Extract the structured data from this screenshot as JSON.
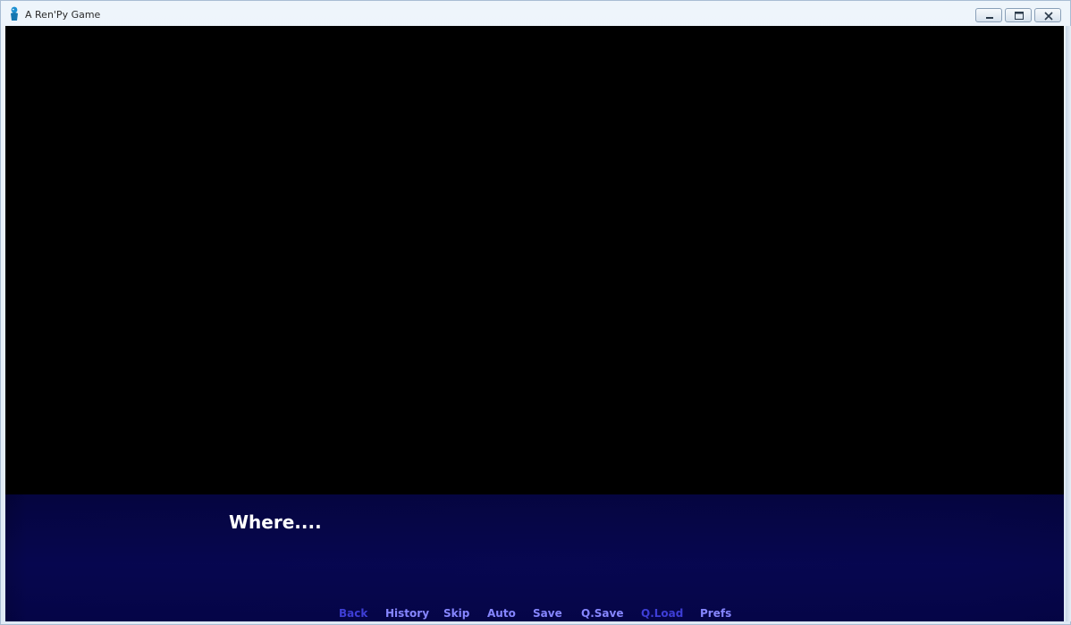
{
  "window": {
    "title": "A Ren'Py Game",
    "icon": "renpy-icon",
    "controls": [
      "minimize-icon",
      "maximize-icon",
      "close-icon"
    ]
  },
  "dialogue": {
    "text": "Where...."
  },
  "quick_menu": {
    "items": [
      {
        "label": "Back",
        "state": "disabled"
      },
      {
        "label": "History",
        "state": "enabled"
      },
      {
        "label": "Skip",
        "state": "enabled"
      },
      {
        "label": "Auto",
        "state": "enabled"
      },
      {
        "label": "Save",
        "state": "enabled"
      },
      {
        "label": "Q.Save",
        "state": "enabled"
      },
      {
        "label": "Q.Load",
        "state": "disabled"
      },
      {
        "label": "Prefs",
        "state": "enabled"
      }
    ]
  },
  "colors": {
    "viewport_bg": "#000000",
    "textbox_bg": "#060647",
    "dialogue_text": "#ffffff",
    "menu_enabled": "#8686ff",
    "menu_disabled": "#3e3ed6"
  }
}
